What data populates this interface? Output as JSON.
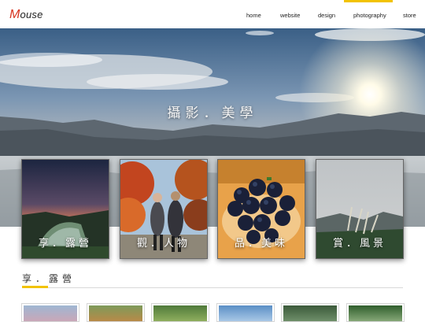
{
  "logo": {
    "first_letter": "M",
    "rest": "ouse"
  },
  "nav": {
    "items": [
      {
        "label": "home"
      },
      {
        "label": "website"
      },
      {
        "label": "design"
      },
      {
        "label": "photography"
      },
      {
        "label": "store"
      }
    ],
    "active_index": 3
  },
  "hero": {
    "title": "攝影．美學"
  },
  "cards": [
    {
      "label": "享．露營"
    },
    {
      "label": "觀．人物"
    },
    {
      "label": "品．美味"
    },
    {
      "label": "賞．風景"
    }
  ],
  "section": {
    "title": "享．露營"
  },
  "colors": {
    "accent": "#f2c300",
    "logo_red": "#d7321e"
  }
}
